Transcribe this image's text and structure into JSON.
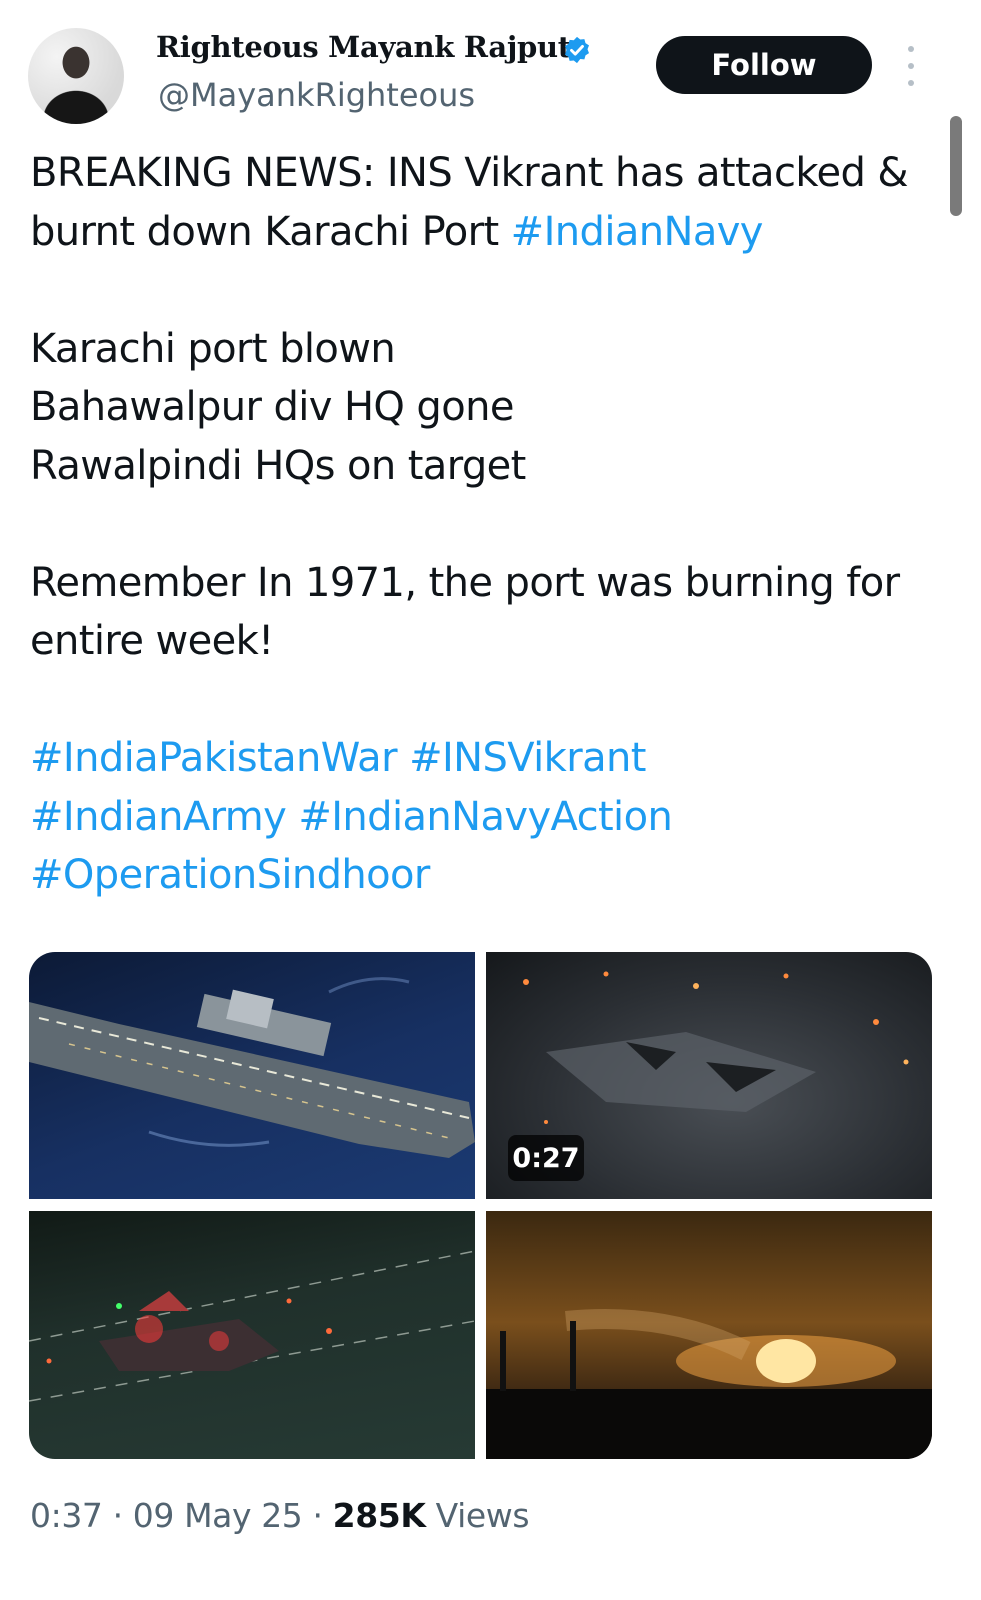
{
  "author": {
    "name": "Righteous Mayank Rajput",
    "handle": "@MayankRighteous",
    "verified_icon": "verified-badge-icon"
  },
  "header": {
    "follow_label": "Follow",
    "more_icon": "more-vertical-icon"
  },
  "tweet": {
    "line1_text": "BREAKING NEWS: INS Vikrant has attacked & burnt down Karachi Port ",
    "line1_hashtag": "#IndianNavy",
    "line2": "Karachi port blown",
    "line3": "Bahawalpur div HQ gone",
    "line4": "Rawalpindi HQs on target",
    "line5": "Remember In 1971, the port was burning for entire week!",
    "hashtags": [
      "#IndiaPakistanWar",
      "#INSVikrant",
      "#IndianArmy",
      "#IndianNavyAction",
      "#OperationSindhoor"
    ]
  },
  "media": {
    "video_duration": "0:27"
  },
  "footer": {
    "time": "0:37",
    "sep1": "·",
    "date": "09 May 25",
    "sep2": "·",
    "views_count": "285K",
    "views_label": "Views"
  },
  "colors": {
    "link": "#1d9bf0",
    "text": "#0f1419",
    "secondary": "#536471",
    "button": "#0f1419"
  }
}
